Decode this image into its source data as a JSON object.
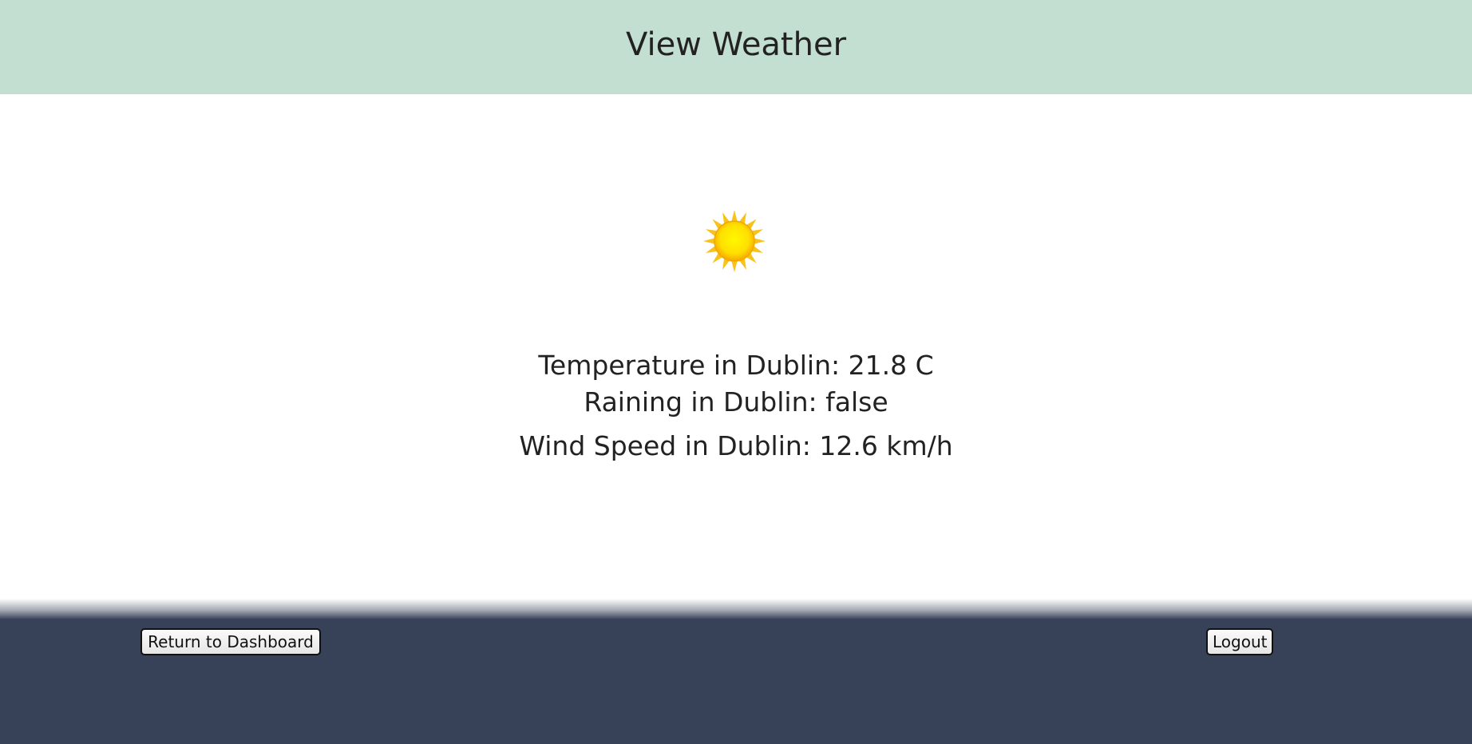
{
  "header": {
    "title": "View Weather"
  },
  "weather": {
    "icon": "sun-icon",
    "temperature_text": "Temperature in Dublin: 21.8 C",
    "raining_text": "Raining in Dublin: false",
    "wind_text": "Wind Speed in Dublin: 12.6 km/h"
  },
  "footer": {
    "dashboard_label": "Return to Dashboard",
    "logout_label": "Logout"
  },
  "colors": {
    "header_bg": "#c2dfd1",
    "footer_bg": "#374158",
    "sun_core": "#ffe600",
    "sun_rays": "#f5b800"
  }
}
